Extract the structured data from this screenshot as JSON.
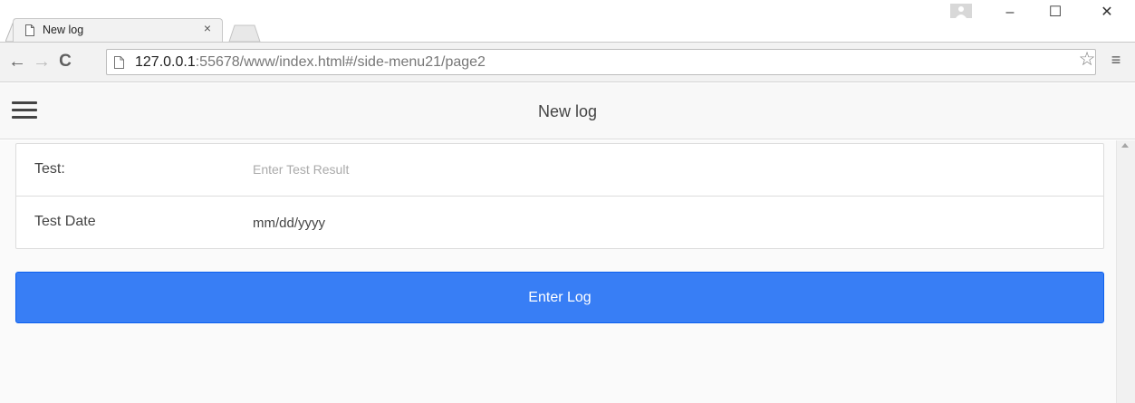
{
  "browser": {
    "tab": {
      "title": "New log",
      "close_glyph": "×",
      "icon": "page-icon"
    },
    "window_controls": {
      "minimize": "–",
      "maximize": "☐",
      "close": "✕"
    },
    "url": {
      "host": "127.0.0.1",
      "rest": ":55678/www/index.html#/side-menu21/page2"
    },
    "icons": {
      "back": "←",
      "forward": "→",
      "reload": "C",
      "star": "☆",
      "menu": "≡"
    }
  },
  "header": {
    "title": "New log",
    "menu_icon": "hamburger-icon"
  },
  "form": {
    "fields": [
      {
        "label": "Test:",
        "placeholder": "Enter Test Result",
        "value": ""
      },
      {
        "label": "Test Date",
        "value": "mm/dd/yyyy"
      }
    ],
    "submit_label": "Enter Log"
  },
  "colors": {
    "button": "#387ef5",
    "header_bg": "#f8f8f8",
    "content_bg": "#fafafa"
  }
}
